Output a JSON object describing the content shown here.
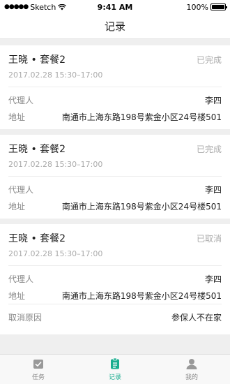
{
  "status_bar": {
    "carrier": "Sketch",
    "time": "9:41 AM",
    "battery": "100%"
  },
  "nav": {
    "title": "记录"
  },
  "records": [
    {
      "title": "王晓 • 套餐2",
      "status": "已完成",
      "time": "2017.02.28 15:30–17:00",
      "agent_label": "代理人",
      "agent": "李四",
      "address_label": "地址",
      "address": "南通市上海东路198号紫金小区24号楼501"
    },
    {
      "title": "王晓 • 套餐2",
      "status": "已完成",
      "time": "2017.02.28 15:30–17:00",
      "agent_label": "代理人",
      "agent": "李四",
      "address_label": "地址",
      "address": "南通市上海东路198号紫金小区24号楼501"
    },
    {
      "title": "王晓 • 套餐2",
      "status": "已取消",
      "time": "2017.02.28 15:30–17:00",
      "agent_label": "代理人",
      "agent": "李四",
      "address_label": "地址",
      "address": "南通市上海东路198号紫金小区24号楼501",
      "cancel_label": "取消原因",
      "cancel_reason": "参保人不在家"
    }
  ],
  "tabs": [
    {
      "label": "任务",
      "icon": "task-icon",
      "active": false
    },
    {
      "label": "记录",
      "icon": "record-icon",
      "active": true
    },
    {
      "label": "我的",
      "icon": "person-icon",
      "active": false
    }
  ],
  "colors": {
    "accent": "#1aad8f",
    "inactive": "#888888"
  }
}
